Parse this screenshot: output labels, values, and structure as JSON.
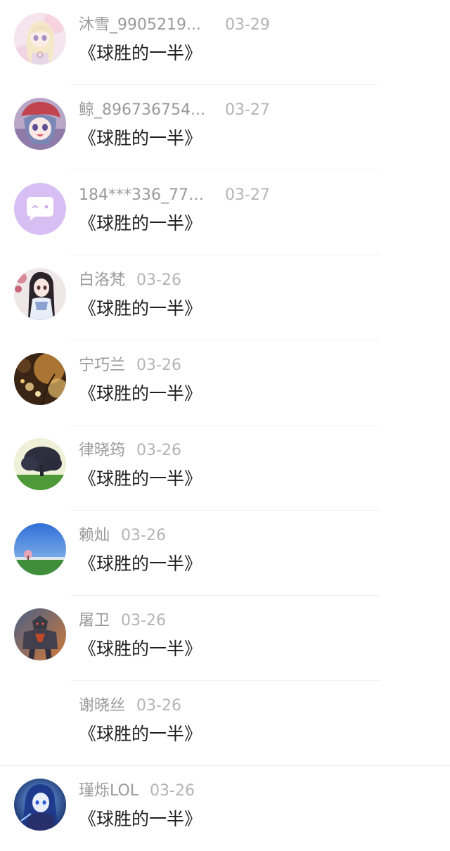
{
  "comments": [
    {
      "name": "沐雪_9905219...",
      "date": "03-29",
      "message": "《球胜的一半》",
      "avatar_icon": "anime-girl-pink-avatar"
    },
    {
      "name": "鲸_896736754...",
      "date": "03-27",
      "message": "《球胜的一半》",
      "avatar_icon": "anime-girl-red-cap-avatar"
    },
    {
      "name": "184***336_770...",
      "date": "03-27",
      "message": "《球胜的一半》",
      "avatar_icon": "default-chat-bubble-avatar"
    },
    {
      "name": "白洛梵",
      "date": "03-26",
      "message": "《球胜的一半》",
      "avatar_icon": "anime-girl-dark-hair-avatar"
    },
    {
      "name": "宁巧兰",
      "date": "03-26",
      "message": "《球胜的一半》",
      "avatar_icon": "autumn-bokeh-avatar"
    },
    {
      "name": "律晓筠",
      "date": "03-26",
      "message": "《球胜的一半》",
      "avatar_icon": "tree-field-avatar"
    },
    {
      "name": "赖灿",
      "date": "03-26",
      "message": "《球胜的一半》",
      "avatar_icon": "blue-sky-landscape-avatar"
    },
    {
      "name": "屠卫",
      "date": "03-26",
      "message": "《球胜的一半》",
      "avatar_icon": "armored-warrior-avatar"
    },
    {
      "name": "谢晓丝",
      "date": "03-26",
      "message": "《球胜的一半》",
      "avatar_icon": ""
    },
    {
      "name": "瑾烁LOL",
      "date": "03-26",
      "message": "《球胜的一半》",
      "avatar_icon": "blue-haired-hero-avatar"
    }
  ],
  "colors": {
    "name": "#9a9a9a",
    "date": "#b4b4b4",
    "message": "#1f1f1f",
    "divider": "#f1f1f1",
    "default_avatar_bg": "#d7bff4"
  }
}
